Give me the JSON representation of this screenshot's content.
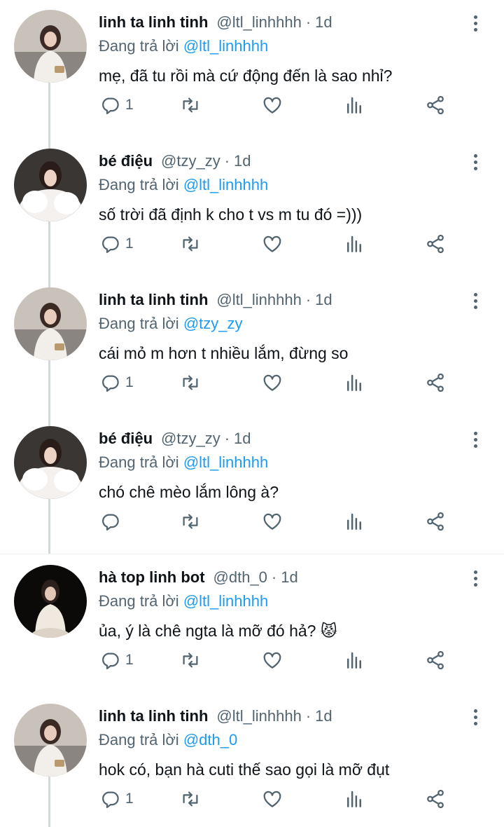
{
  "thread": {
    "tweets": [
      {
        "name": "linh ta linh tinh",
        "handle": "@ltl_linhhhh",
        "dot": "·",
        "time": "1d",
        "replying_label": "Đang trả lời",
        "replying_to": "@ltl_linhhhh",
        "text": "mẹ, đã tu rồi mà cứ động đến là sao nhỉ?",
        "reply_count": "1",
        "avatar": "avatar-linh"
      },
      {
        "name": "bé điệu",
        "handle": "@tzy_zy",
        "dot": "·",
        "time": "1d",
        "replying_label": "Đang trả lời",
        "replying_to": "@ltl_linhhhh",
        "text": "số trời đã định k cho t vs m tu đó =)))",
        "reply_count": "1",
        "avatar": "avatar-dieu"
      },
      {
        "name": "linh ta linh tinh",
        "handle": "@ltl_linhhhh",
        "dot": "·",
        "time": "1d",
        "replying_label": "Đang trả lời",
        "replying_to": "@tzy_zy",
        "text": "cái mỏ m hơn t nhiều lắm, đừng so",
        "reply_count": "1",
        "avatar": "avatar-linh"
      },
      {
        "name": "bé điệu",
        "handle": "@tzy_zy",
        "dot": "·",
        "time": "1d",
        "replying_label": "Đang trả lời",
        "replying_to": "@ltl_linhhhh",
        "text": "chó chê mèo lắm lông à?",
        "reply_count": "",
        "avatar": "avatar-dieu"
      },
      {
        "name": "hà top linh bot",
        "handle": "@dth_0",
        "dot": "·",
        "time": "1d",
        "replying_label": "Đang trả lời",
        "replying_to": "@ltl_linhhhh",
        "text": "ủa, ý là chê ngta là mỡ đó hả? 😾",
        "reply_count": "1",
        "avatar": "avatar-ha"
      },
      {
        "name": "linh ta linh tinh",
        "handle": "@ltl_linhhhh",
        "dot": "·",
        "time": "1d",
        "replying_label": "Đang trả lời",
        "replying_to": "@dth_0",
        "text": "hok có, bạn hà cuti thế  sao gọi là mỡ đụt",
        "reply_count": "1",
        "avatar": "avatar-linh"
      }
    ]
  },
  "icons": {
    "reply": "reply-icon",
    "retweet": "retweet-icon",
    "like": "heart-icon",
    "stats": "stats-icon",
    "share": "share-icon",
    "more": "more-icon"
  },
  "colors": {
    "mention": "#1d9bf0",
    "secondary": "#536471",
    "primary_text": "#0f1419",
    "thread_line": "#cfd9de"
  }
}
